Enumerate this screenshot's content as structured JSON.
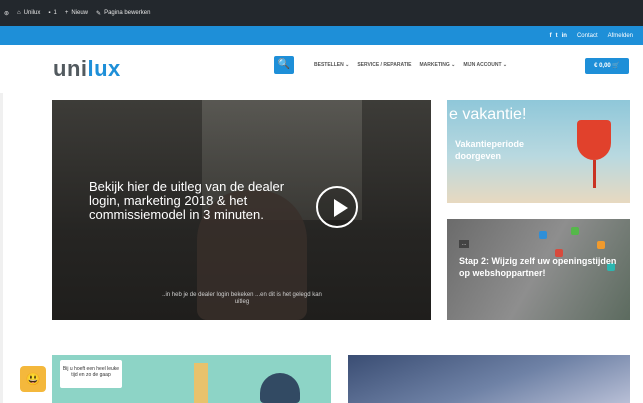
{
  "adminbar": {
    "items": [
      {
        "icon": "wordpress-icon",
        "label": ""
      },
      {
        "icon": "home-icon",
        "label": "Unilux"
      },
      {
        "icon": "comment-icon",
        "label": "1"
      },
      {
        "icon": "plus-icon",
        "label": "Nieuw"
      },
      {
        "icon": "pencil-icon",
        "label": "Pagina bewerken"
      }
    ]
  },
  "topbar": {
    "social": [
      "f",
      "t",
      "in"
    ],
    "links": [
      "Contact",
      "Afmelden"
    ]
  },
  "header": {
    "logo_part1": "uni",
    "logo_part2": "lux",
    "search_icon": "🔍",
    "nav": [
      "BESTELLEN ⌄",
      "SERVICE / REPARATIE",
      "MARKETING ⌄",
      "MIJN ACCOUNT ⌄"
    ],
    "cart": "€ 0,00 🛒"
  },
  "video": {
    "text": "Bekijk hier de uitleg van de dealer login, marketing 2018 & het commissiemodel in 3 minuten.",
    "subtitle": "..in heb je de dealer login bekeken ...en dit is het gelegd kan uitleg"
  },
  "cards": [
    {
      "heading": "e vakantie!",
      "title": "Vakantieperiode doorgeven"
    },
    {
      "badge": "...",
      "title": "Stap 2: Wijzig zelf uw openingstijden op webshoppartner!"
    }
  ],
  "bottom": {
    "speech": "Bij u hoeft een heel leuke tijd en zo de gaap"
  },
  "widget": {
    "icon": "chat-icon",
    "glyph": "😃"
  },
  "colors": {
    "brand": "#1e8fd8",
    "adminbar": "#23282d"
  }
}
